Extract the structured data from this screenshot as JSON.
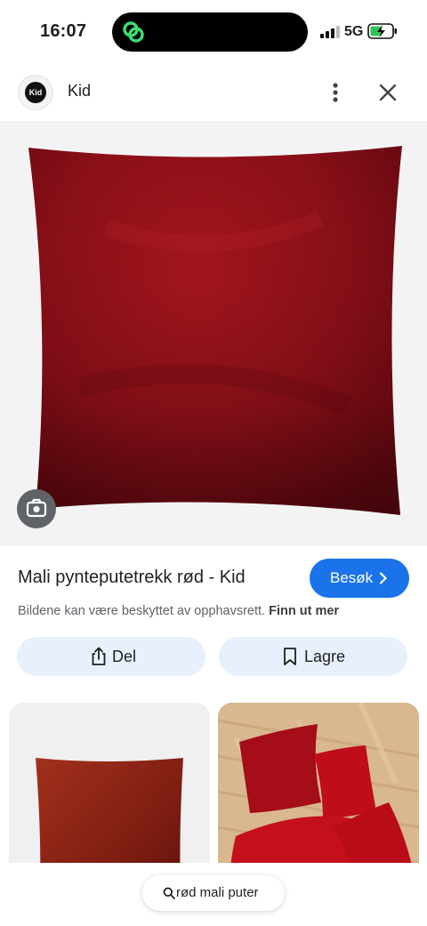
{
  "status_bar": {
    "time": "16:07",
    "network": "5G",
    "icons": [
      "link-app-icon",
      "signal-icon",
      "battery-charging-icon"
    ]
  },
  "header": {
    "logo_text": "Kid",
    "site_name": "Kid",
    "icons": [
      "more-vert-icon",
      "close-icon"
    ]
  },
  "image": {
    "subject": "red velvet cushion cover",
    "lens_icon": "google-lens-icon"
  },
  "result": {
    "title": "Mali pynteputetrekk rød - Kid",
    "visit_label": "Besøk",
    "copyright_text": "Bildene kan være beskyttet av opphavsrett.",
    "learn_more": "Finn ut mer"
  },
  "actions": {
    "share_label": "Del",
    "save_label": "Lagre"
  },
  "bottom": {
    "search_query": "rød mali puter"
  },
  "colors": {
    "accent": "#1a73e8",
    "action_bg": "#e8f0fe",
    "cushion_red": "#8e1019"
  }
}
